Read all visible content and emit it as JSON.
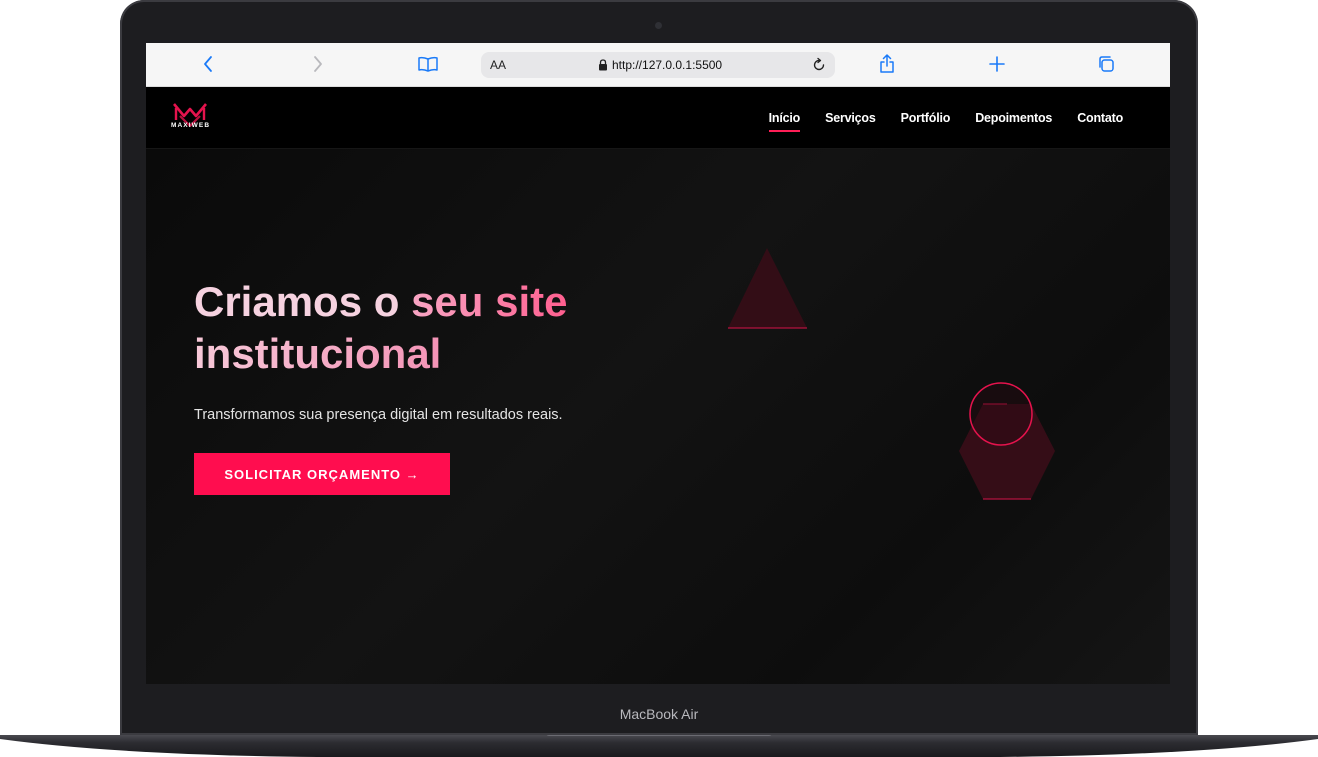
{
  "device": {
    "brand_label": "MacBook Air"
  },
  "browser": {
    "text_size_label": "AA",
    "url": "http://127.0.0.1:5500",
    "icons": [
      "chevron-left-icon",
      "chevron-right-icon",
      "book-icon",
      "lock-icon",
      "reload-icon",
      "share-icon",
      "plus-icon",
      "tabs-icon"
    ]
  },
  "site": {
    "logo_text": "MAXIWEB",
    "nav": [
      {
        "label": "Início",
        "active": true
      },
      {
        "label": "Serviços",
        "active": false
      },
      {
        "label": "Portfólio",
        "active": false
      },
      {
        "label": "Depoimentos",
        "active": false
      },
      {
        "label": "Contato",
        "active": false
      }
    ],
    "hero": {
      "title_part1": "Criamos o ",
      "title_part2": "seu site",
      "title_line2": "institucional",
      "subtitle": "Transformamos sua presença digital em resultados reais.",
      "cta_label": "SOLICITAR ORÇAMENTO →"
    }
  },
  "colors": {
    "accent": "#ff0d4f",
    "accent_dark": "#8a0d2e",
    "background": "#0a0a0a"
  }
}
